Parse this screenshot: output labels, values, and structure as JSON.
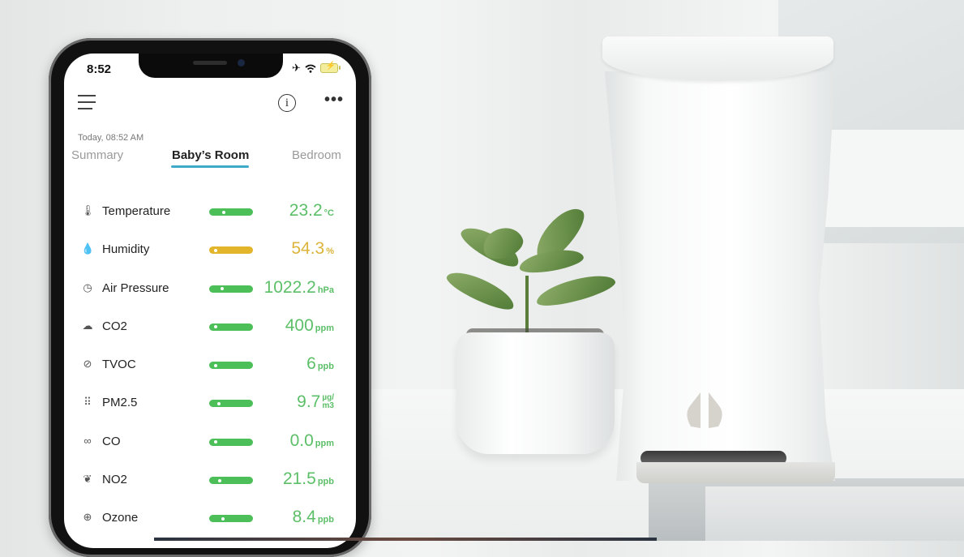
{
  "status_bar": {
    "time": "8:52",
    "icons": [
      "airplane-icon",
      "wifi-icon",
      "battery-charging-icon"
    ]
  },
  "header": {
    "menu_icon": "hamburger-icon",
    "info_icon": "info-icon",
    "info_glyph": "i",
    "more_icon": "more-icon",
    "more_glyph": "•••"
  },
  "date_label": "Today, 08:52 AM",
  "tabs": [
    {
      "label": "Summary",
      "active": false
    },
    {
      "label": "Baby’s Room",
      "active": true
    },
    {
      "label": "Bedroom",
      "active": false
    }
  ],
  "colors": {
    "good": "#4cbf58",
    "moderate": "#e3b52a",
    "tab_accent": "#3fa9c9",
    "value_good": "#5cbf68",
    "value_moderate": "#dcb43a"
  },
  "metrics": [
    {
      "name": "Temperature",
      "icon": "thermometer-icon",
      "glyph": "🌡",
      "value": "23.2",
      "unit": "°C",
      "status": "good",
      "level": 0.3
    },
    {
      "name": "Humidity",
      "icon": "droplet-icon",
      "glyph": "💧",
      "value": "54.3",
      "unit": "%",
      "status": "moderate",
      "level": 0.12
    },
    {
      "name": "Air Pressure",
      "icon": "gauge-icon",
      "glyph": "◷",
      "value": "1022.2",
      "unit": "hPa",
      "status": "good",
      "level": 0.25
    },
    {
      "name": "CO2",
      "icon": "cloud-icon",
      "glyph": "☁",
      "value": "400",
      "unit": "ppm",
      "status": "good",
      "level": 0.12
    },
    {
      "name": "TVOC",
      "icon": "leaf-icon",
      "glyph": "⊘",
      "value": "6",
      "unit": "ppb",
      "status": "good",
      "level": 0.12
    },
    {
      "name": "PM2.5",
      "icon": "particles-icon",
      "glyph": "⠿",
      "value": "9.7",
      "unit_top": "µg/",
      "unit_bottom": "m3",
      "status": "good",
      "level": 0.18
    },
    {
      "name": "CO",
      "icon": "molecule-icon",
      "glyph": "∞",
      "value": "0.0",
      "unit": "ppm",
      "status": "good",
      "level": 0.12
    },
    {
      "name": "NO2",
      "icon": "no2-icon",
      "glyph": "❦",
      "value": "21.5",
      "unit": "ppb",
      "status": "good",
      "level": 0.2
    },
    {
      "name": "Ozone",
      "icon": "globe-icon",
      "glyph": "⊕",
      "value": "8.4",
      "unit": "ppb",
      "status": "good",
      "level": 0.28
    }
  ]
}
